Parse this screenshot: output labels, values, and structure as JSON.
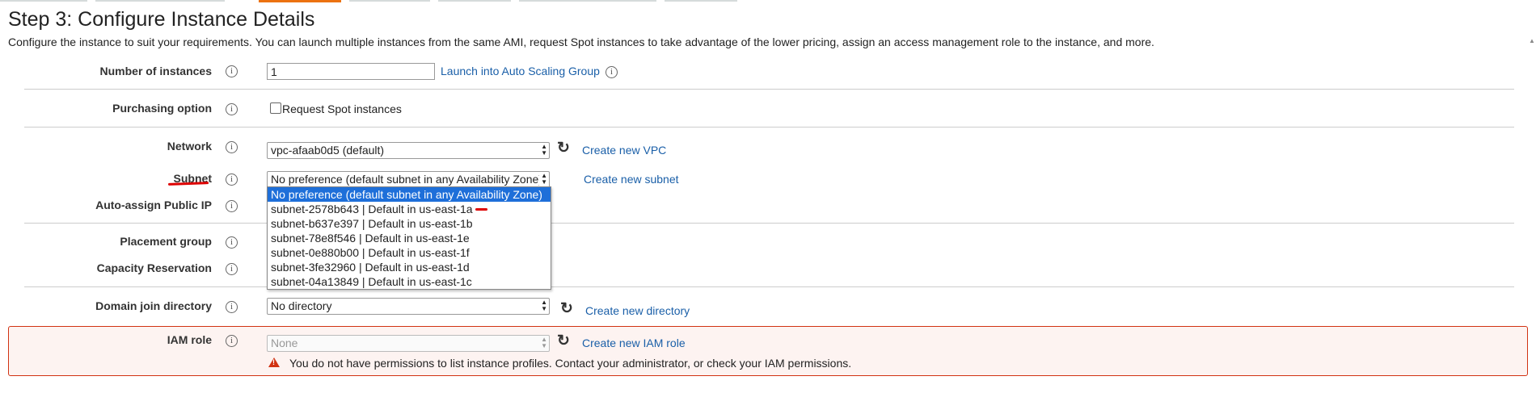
{
  "header": {
    "title": "Step 3: Configure Instance Details",
    "description": "Configure the instance to suit your requirements. You can launch multiple instances from the same AMI, request Spot instances to take advantage of the lower pricing, assign an access management role to the instance, and more."
  },
  "info_glyph": "i",
  "fields": {
    "number_of_instances": {
      "label": "Number of instances",
      "value": "1",
      "link": "Launch into Auto Scaling Group"
    },
    "purchasing_option": {
      "label": "Purchasing option",
      "checkbox_label": "Request Spot instances"
    },
    "network": {
      "label": "Network",
      "value": "vpc-afaab0d5 (default)",
      "link": "Create new VPC"
    },
    "subnet": {
      "label": "Subnet",
      "value": "No preference (default subnet in any Availability Zone)",
      "link": "Create new subnet",
      "options": [
        "No preference (default subnet in any Availability Zone)",
        "subnet-2578b643 | Default in us-east-1a",
        "subnet-b637e397 | Default in us-east-1b",
        "subnet-78e8f546 | Default in us-east-1e",
        "subnet-0e880b00 | Default in us-east-1f",
        "subnet-3fe32960 | Default in us-east-1d",
        "subnet-04a13849 | Default in us-east-1c"
      ]
    },
    "auto_assign_ip": {
      "label": "Auto-assign Public IP"
    },
    "placement_group": {
      "label": "Placement group"
    },
    "capacity_reservation": {
      "label": "Capacity Reservation"
    },
    "domain_join": {
      "label": "Domain join directory",
      "value": "No directory",
      "link": "Create new directory"
    },
    "iam_role": {
      "label": "IAM role",
      "value": "None",
      "link": "Create new IAM role",
      "warning": "You do not have permissions to list instance profiles. Contact your administrator, or check your IAM permissions."
    }
  },
  "colors": {
    "accent": "#ec7211",
    "link": "#1a5fa8",
    "error": "#d13212",
    "selected": "#1e6fd9"
  }
}
